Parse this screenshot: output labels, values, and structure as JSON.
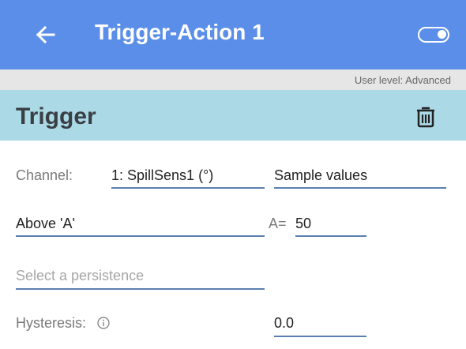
{
  "appbar": {
    "title": "Trigger-Action 1",
    "back_icon": "arrow-left-icon",
    "toggle_icon": "toggle-on-icon",
    "color": "#5a8ee8"
  },
  "user_level": "User level: Advanced",
  "section": {
    "title": "Trigger",
    "delete_icon": "trash-icon",
    "color": "#abd9e6"
  },
  "form": {
    "channel_label": "Channel:",
    "channel_value": "1: SpillSens1 (°)",
    "sample_mode": "Sample values",
    "condition": "Above 'A'",
    "a_label": "A=",
    "a_value": "50",
    "persistence_placeholder": "Select a persistence",
    "hysteresis_label": "Hysteresis:",
    "hysteresis_value": "0.0",
    "info_icon": "info-circle-icon"
  }
}
